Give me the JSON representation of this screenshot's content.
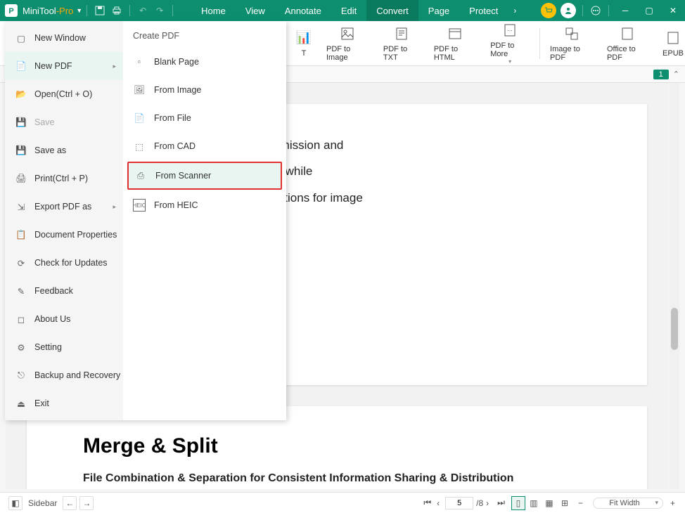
{
  "app": {
    "title_prefix": "MiniTool",
    "title_suffix": "-Pro"
  },
  "menu": {
    "items": [
      "Home",
      "View",
      "Annotate",
      "Edit",
      "Convert",
      "Page",
      "Protect"
    ],
    "active_index": 4
  },
  "ribbon": {
    "items": [
      {
        "label_suffix": "T",
        "name": "pdf-to-ppt"
      },
      {
        "label": "PDF to Image",
        "name": "pdf-to-image"
      },
      {
        "label": "PDF to TXT",
        "name": "pdf-to-txt"
      },
      {
        "label": "PDF to HTML",
        "name": "pdf-to-html"
      },
      {
        "label": "PDF to More",
        "name": "pdf-to-more",
        "dropdown": true
      }
    ],
    "items_right": [
      {
        "label": "Image to PDF",
        "name": "image-to-pdf"
      },
      {
        "label": "Office to PDF",
        "name": "office-to-pdf"
      },
      {
        "label_prefix": "EPUB",
        "name": "epub-to-pdf"
      }
    ]
  },
  "tabstrip": {
    "page_badge": "1"
  },
  "file_menu": {
    "items": [
      {
        "label": "New Window",
        "icon": "window"
      },
      {
        "label": "New PDF",
        "icon": "new-pdf",
        "submenu": true,
        "active": true
      },
      {
        "label": "Open(Ctrl + O)",
        "icon": "folder"
      },
      {
        "label": "Save",
        "icon": "save",
        "disabled": true
      },
      {
        "label": "Save as",
        "icon": "save-as"
      },
      {
        "label": "Print(Ctrl + P)",
        "icon": "print"
      },
      {
        "label": "Export PDF as",
        "icon": "export",
        "submenu": true
      },
      {
        "label": "Document Properties",
        "icon": "doc-props"
      },
      {
        "label": "Check for Updates",
        "icon": "update"
      },
      {
        "label": "Feedback",
        "icon": "feedback"
      },
      {
        "label": "About Us",
        "icon": "about"
      },
      {
        "label": "Setting",
        "icon": "setting"
      },
      {
        "label": "Backup and Recovery",
        "icon": "backup"
      },
      {
        "label": "Exit",
        "icon": "exit"
      }
    ],
    "submenu_header": "Create PDF",
    "submenu_items": [
      {
        "label": "Blank Page",
        "icon": "blank"
      },
      {
        "label": "From Image",
        "icon": "from-image"
      },
      {
        "label": "From File",
        "icon": "from-file"
      },
      {
        "label": "From CAD",
        "icon": "from-cad"
      },
      {
        "label": "From Scanner",
        "icon": "from-scanner",
        "highlighted": true
      },
      {
        "label": "From HEIC",
        "icon": "from-heic"
      }
    ]
  },
  "document": {
    "line1": "ant it to be smaller for faster file transmission and",
    "line2": "Compression\" to optimize the file size while",
    "line3": "MiniTool PDF Editor provides three options for image",
    "heading": "Merge & Split",
    "subheading": "File Combination & Separation for Consistent Information Sharing & Distribution"
  },
  "statusbar": {
    "sidebar_label": "Sidebar",
    "current_page": "5",
    "total_pages": "/8",
    "zoom_label": "Fit Width"
  }
}
